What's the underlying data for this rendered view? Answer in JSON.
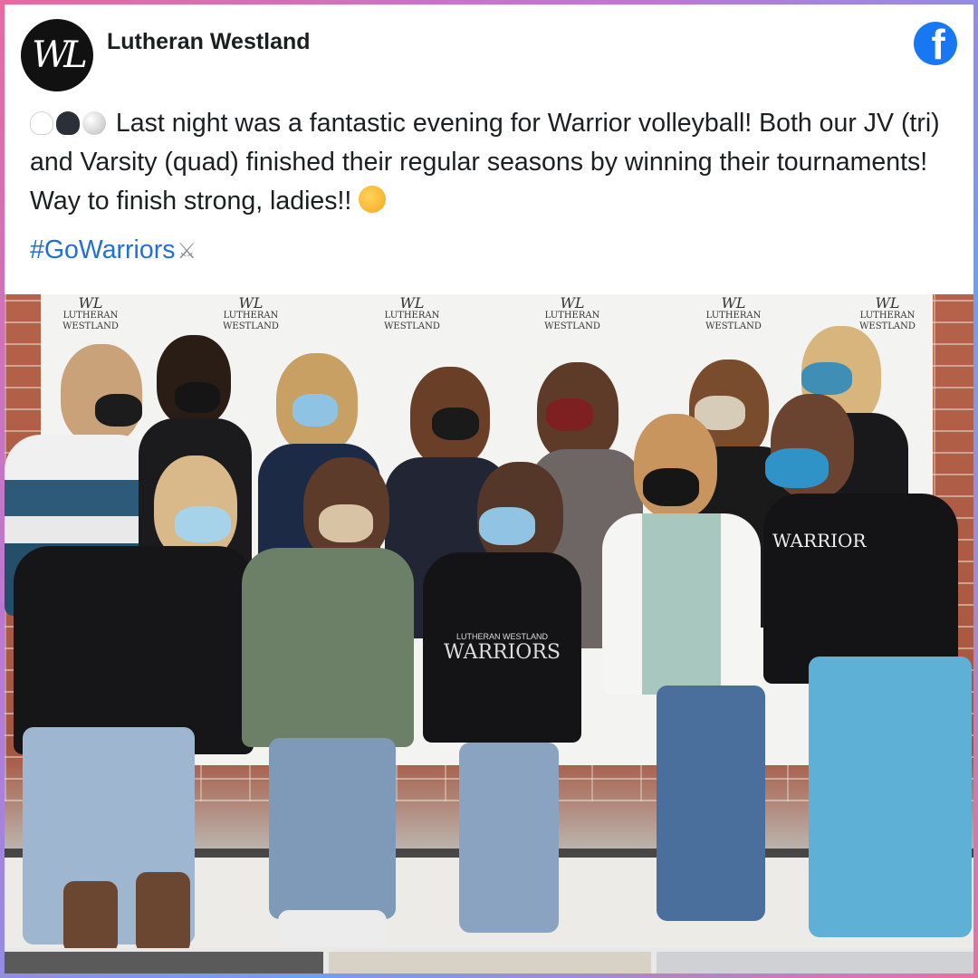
{
  "post": {
    "page_name": "Lutheran Westland",
    "avatar_initials": "WL",
    "platform_icon": "facebook-icon",
    "emojis": [
      "white-heart-icon",
      "black-heart-icon",
      "volleyball-icon"
    ],
    "text_main": "Last night was a fantastic evening for Warrior volleyball! Both our JV (tri) and Varsity (quad) finished their regular seasons by winning their tournaments!  Way to finish strong, ladies!!",
    "trailing_emoji": "clapping-hands-icon",
    "hashtag": "#GoWarriors",
    "hashtag_emoji": "crossed-swords-icon"
  },
  "photo": {
    "backdrop_logo_lines": [
      "LUTHERAN",
      "WESTLAND"
    ],
    "backdrop_monogram": "WL",
    "sweatshirt_text_1": "LUTHERAN WESTLAND",
    "sweatshirt_text_2": "WARRIORS",
    "sweatshirt_text_3": "WARRIOR"
  },
  "colors": {
    "facebook_blue": "#1877f2",
    "hashtag_blue": "#216fdb",
    "frame_gradient": [
      "#e86aa0",
      "#b77ad6",
      "#6f9ff0"
    ]
  }
}
